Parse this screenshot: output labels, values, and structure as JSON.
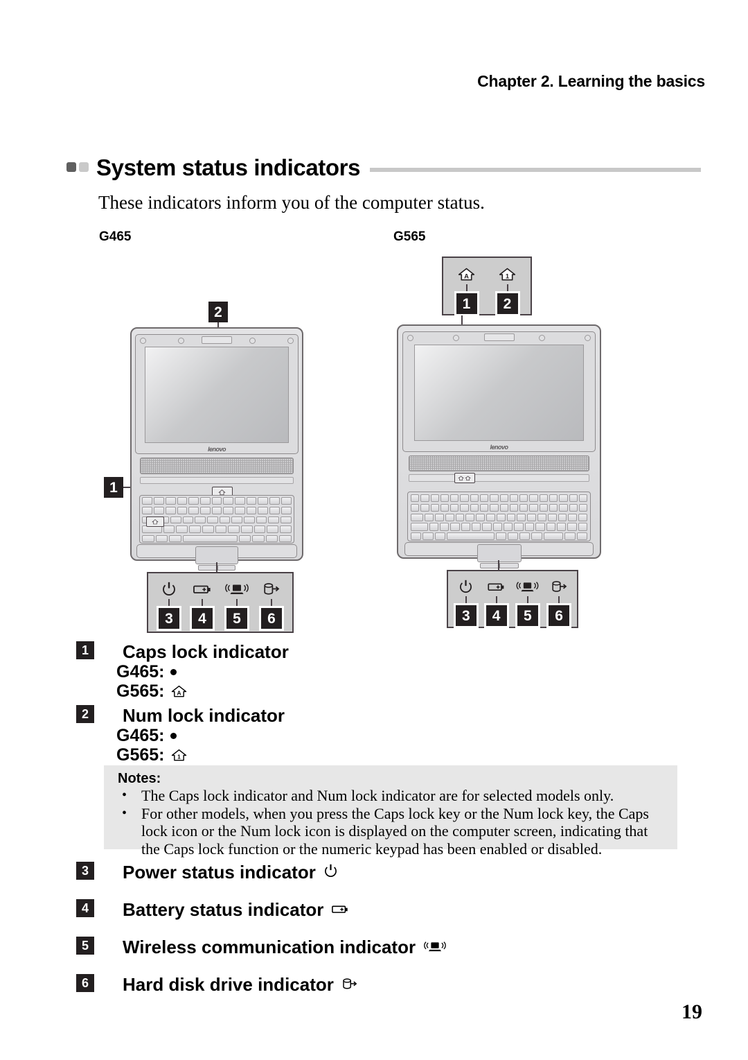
{
  "header": {
    "chapter": "Chapter 2. Learning the basics"
  },
  "section": {
    "title": "System status indicators",
    "intro": "These indicators inform you of the computer status."
  },
  "figures": {
    "left_model": "G465",
    "right_model": "G565",
    "g565_callout_box": {
      "items": [
        {
          "icon": "caps-lock-icon",
          "badge": "1"
        },
        {
          "icon": "num-lock-icon",
          "badge": "2"
        }
      ]
    },
    "g465_callouts": [
      {
        "badge": "1",
        "target": "caps-lock-key"
      },
      {
        "badge": "2",
        "target": "num-lock-key"
      }
    ],
    "indicator_panel": {
      "items": [
        {
          "icon": "power-icon",
          "badge": "3"
        },
        {
          "icon": "battery-icon",
          "badge": "4"
        },
        {
          "icon": "wireless-icon",
          "badge": "5"
        },
        {
          "icon": "hard-disk-icon",
          "badge": "6"
        }
      ]
    },
    "brand": "lenovo"
  },
  "indicator_list": [
    {
      "badge": "1",
      "label": "Caps lock indicator",
      "variants": [
        {
          "model": "G465:",
          "icon": "dot-icon"
        },
        {
          "model": "G565:",
          "icon": "caps-lock-icon"
        }
      ]
    },
    {
      "badge": "2",
      "label": "Num lock indicator",
      "variants": [
        {
          "model": "G465:",
          "icon": "dot-icon"
        },
        {
          "model": "G565:",
          "icon": "num-lock-icon"
        }
      ]
    },
    {
      "badge": "3",
      "label": "Power status indicator",
      "icon": "power-icon"
    },
    {
      "badge": "4",
      "label": "Battery status indicator",
      "icon": "battery-icon"
    },
    {
      "badge": "5",
      "label": "Wireless communication indicator",
      "icon": "wireless-icon"
    },
    {
      "badge": "6",
      "label": "Hard disk drive indicator",
      "icon": "hard-disk-icon"
    }
  ],
  "notes": {
    "title": "Notes:",
    "bullet": "•",
    "items": [
      "The Caps lock indicator and Num lock indicator are for selected models only.",
      "For other models, when you press the Caps lock key or the Num lock key, the Caps lock icon or the Num lock icon is displayed on the computer screen, indicating that the Caps lock function or the numeric keypad has been enabled or disabled."
    ]
  },
  "footer": {
    "page_number": "19"
  },
  "colors": {
    "text": "#000000",
    "rule": "#c8c8c8",
    "badge_bg": "#231f20",
    "notes_bg": "#e7e7e7",
    "panel_bg": "#cdcdcd",
    "square_dark": "#5f5f5f",
    "square_light": "#c9c9c9"
  }
}
